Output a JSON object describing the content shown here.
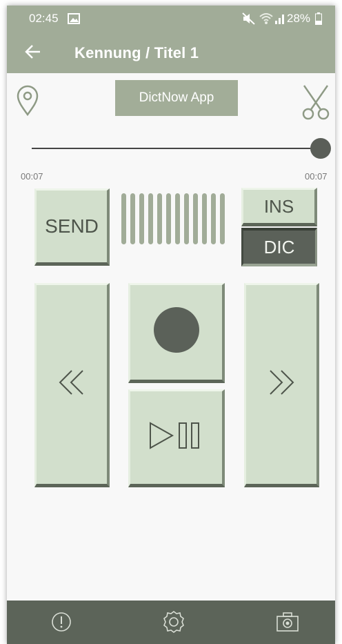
{
  "status_bar": {
    "time": "02:45",
    "battery_text": "28%",
    "icons": [
      "gallery-icon",
      "mute-icon",
      "wifi-icon",
      "signal-icon",
      "battery-icon"
    ]
  },
  "app_bar": {
    "title": "Kennung / Titel 1",
    "back_icon": "arrow-left-icon"
  },
  "header_row": {
    "app_label": "DictNow App",
    "left_icon": "location-pin-icon",
    "right_icon": "scissors-icon"
  },
  "playback": {
    "position_fraction": 1.0,
    "elapsed": "00:07",
    "total": "00:07"
  },
  "controls": {
    "send_label": "SEND",
    "ins_label": "INS",
    "dic_label": "DIC",
    "level_bars": 12,
    "record_icon": "record-icon",
    "rewind_icon": "rewind-icon",
    "forward_icon": "fast-forward-icon",
    "play_pause_icon": "play-pause-icon"
  },
  "bottom_nav": {
    "icons": [
      "info-icon",
      "settings-icon",
      "camera-icon"
    ]
  },
  "colors": {
    "accent": "#a1ac98",
    "button_face": "#d2dfcc",
    "dark": "#5c6459",
    "active": "#5b6159"
  }
}
